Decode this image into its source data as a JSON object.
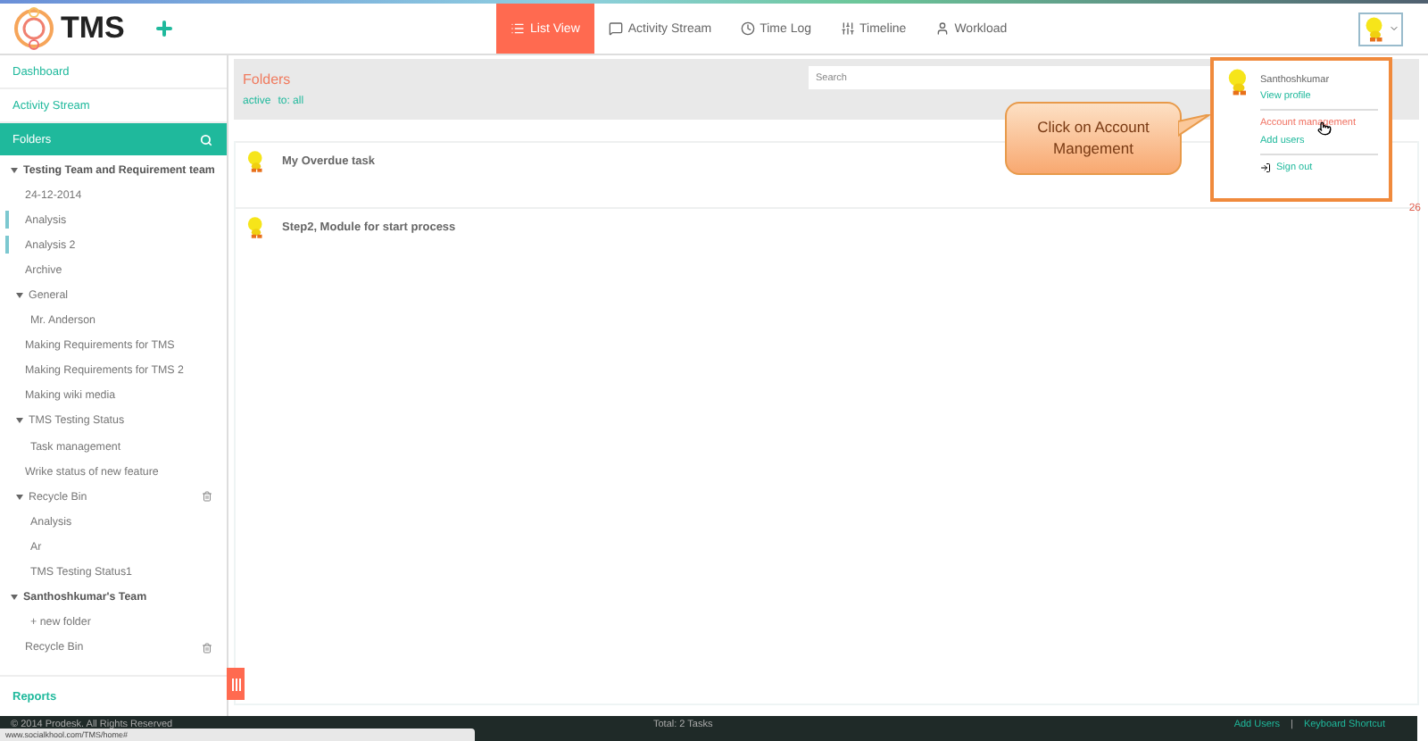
{
  "header": {
    "logo": "TMS",
    "tabs": [
      {
        "label": "List View",
        "kind": "list",
        "selected": true
      },
      {
        "label": "Activity Stream",
        "kind": "stream",
        "selected": false
      },
      {
        "label": "Time Log",
        "kind": "log",
        "selected": false
      },
      {
        "label": "Timeline",
        "kind": "timeline",
        "selected": false
      },
      {
        "label": "Workload",
        "kind": "workload",
        "selected": false
      }
    ]
  },
  "sidebar": {
    "links": [
      "Dashboard",
      "Activity Stream"
    ],
    "folders_title": "Folders",
    "tree": [
      {
        "label": "Testing Team and Requirement team",
        "children": [
          {
            "label": "24-12-2014",
            "marked": false,
            "kind": "folder"
          },
          {
            "label": "Analysis",
            "marked": true,
            "kind": "folder"
          },
          {
            "label": "Analysis 2",
            "marked": true,
            "kind": "folder"
          },
          {
            "label": "Archive",
            "marked": false,
            "kind": "folder"
          },
          {
            "label": "General",
            "marked": false,
            "kind": "folder",
            "children": [
              {
                "label": "Mr. Anderson"
              }
            ]
          },
          {
            "label": "Making Requirements for TMS",
            "marked": false,
            "kind": "folder"
          },
          {
            "label": "Making Requirements for TMS 2",
            "marked": false,
            "kind": "folder"
          },
          {
            "label": "Making wiki media",
            "marked": false,
            "kind": "folder"
          },
          {
            "label": "TMS Testing Status",
            "marked": false,
            "kind": "folder",
            "children": [
              {
                "label": "Task management"
              }
            ]
          },
          {
            "label": "Wrike status of new feature",
            "marked": false,
            "kind": "folder"
          },
          {
            "label": "Recycle Bin",
            "marked": false,
            "kind": "bin",
            "children": [
              {
                "label": "Analysis"
              },
              {
                "label": "Ar"
              },
              {
                "label": "TMS Testing Status1"
              }
            ]
          }
        ]
      },
      {
        "label": "Santhoshkumar's Team",
        "children": [
          {
            "label": "+ new folder",
            "kind": "add"
          },
          {
            "label": "Recycle Bin",
            "kind": "bin"
          }
        ]
      }
    ],
    "reports": "Reports"
  },
  "main": {
    "title": "Folders",
    "filters": [
      "active",
      "to: all"
    ],
    "search": {
      "placeholder": "Search"
    },
    "tasks": [
      {
        "title": "My Overdue task"
      },
      {
        "title": "Step2, Module for start process"
      }
    ],
    "edge_text": "26"
  },
  "user_menu": {
    "name": "Santhoshkumar",
    "view_profile": "View profile",
    "items": [
      {
        "label": "Account management",
        "selected": true
      },
      {
        "label": "Add users",
        "selected": false
      }
    ],
    "sign_out": "Sign out"
  },
  "callout": "Click on Account Mangement",
  "footer": {
    "copyright": "© 2014 Prodesk. All Rights Reserved",
    "total": "Total: 2 Tasks",
    "links": [
      "Add Users",
      "Keyboard Shortcut"
    ],
    "separator": "|",
    "status_url": "www.socialkhool.com/TMS/home#"
  }
}
